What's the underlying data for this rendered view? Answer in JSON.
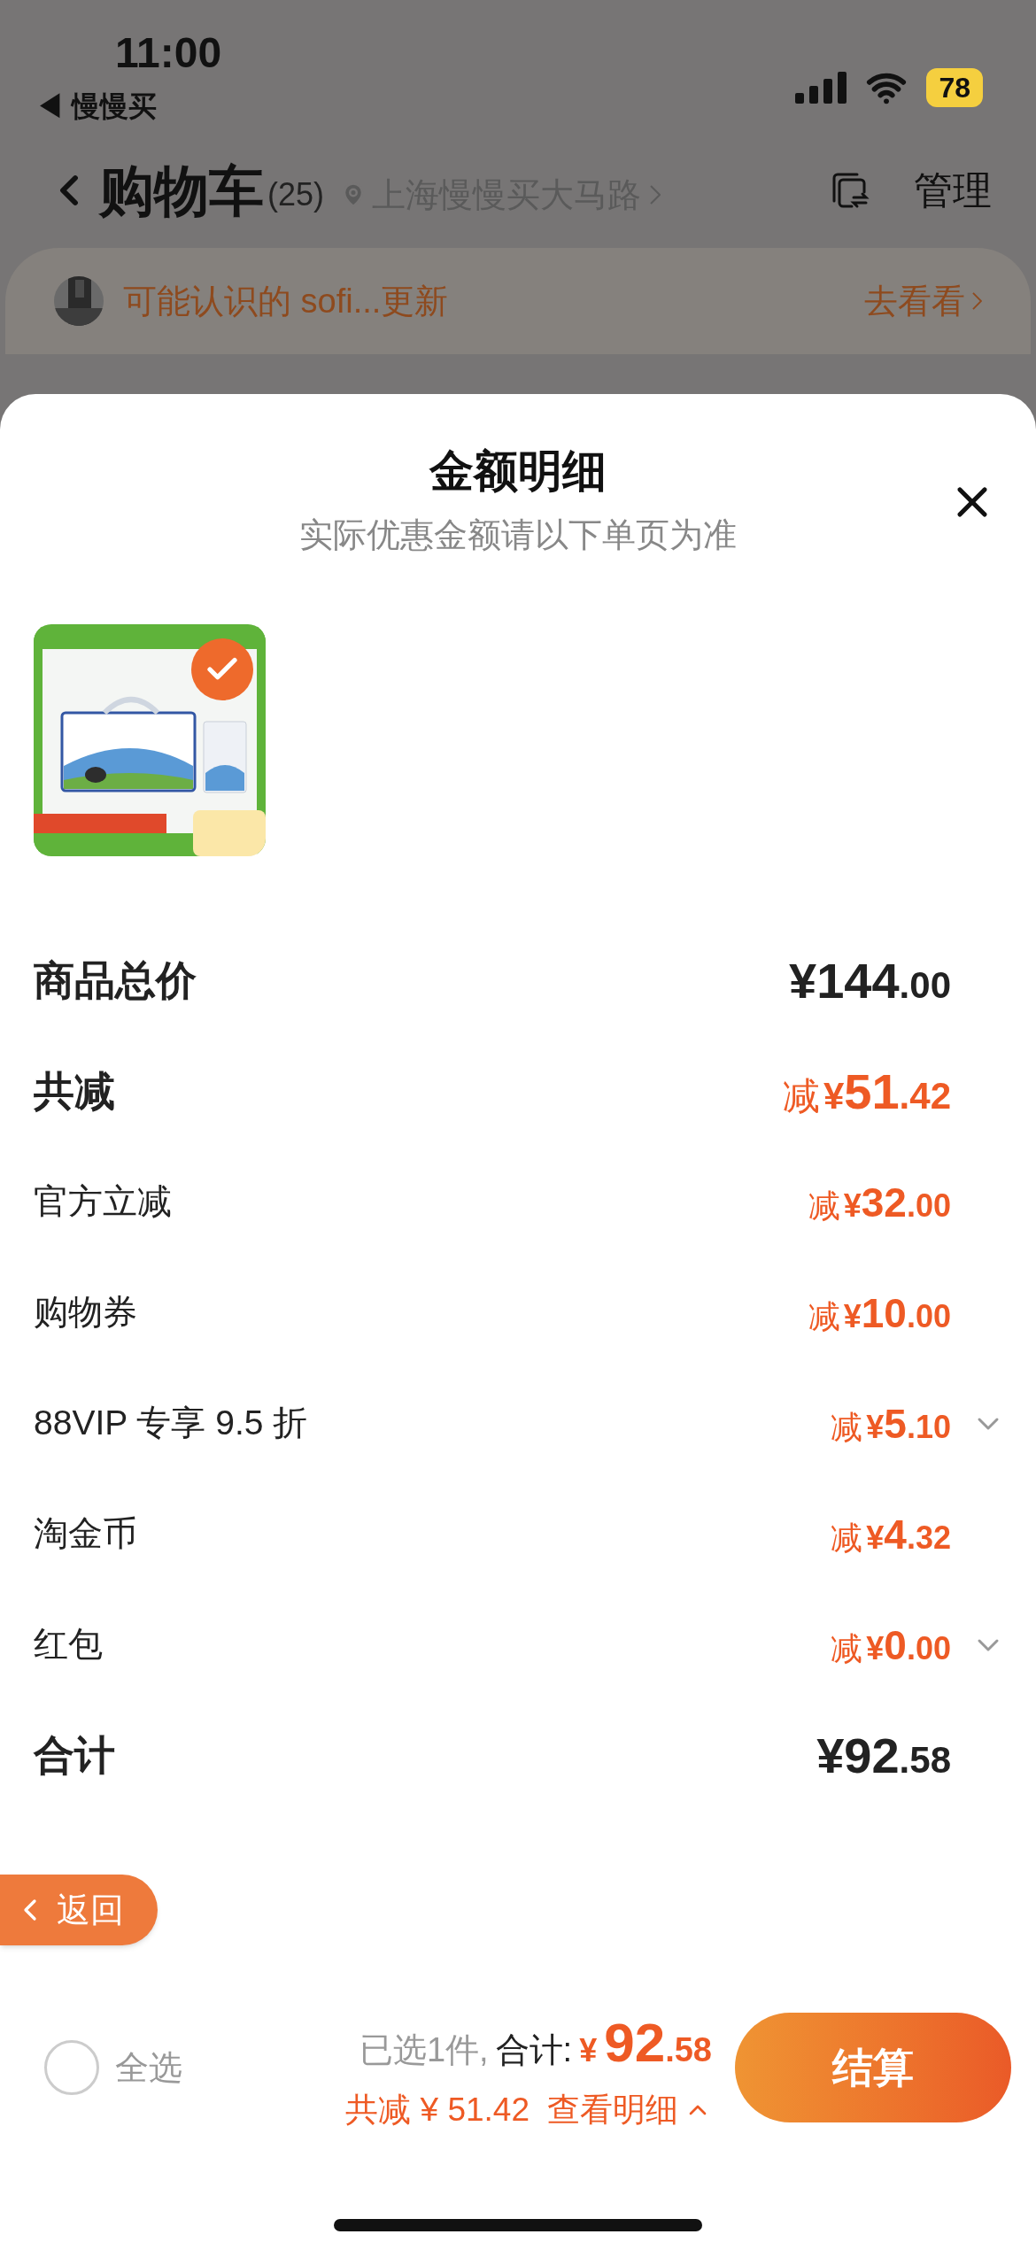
{
  "status_bar": {
    "time": "11:00",
    "back_app": "◀ 慢慢买",
    "battery": "78"
  },
  "header": {
    "title": "购物车",
    "count": "(25)",
    "location": "上海慢慢买大马路",
    "action": "管理"
  },
  "banner": {
    "text": "可能认识的 sofi...更新",
    "link": "去看看"
  },
  "sheet": {
    "title": "金额明细",
    "subtitle": "实际优惠金额请以下单页为准",
    "product": {
      "selected": true
    },
    "rows": [
      {
        "kind": "main",
        "label": "商品总价",
        "integer": "¥144",
        "fraction": ".00",
        "expandable": false
      },
      {
        "kind": "main",
        "label": "共减",
        "prefix": "减",
        "currency": "¥",
        "integer": "51",
        "fraction": ".42",
        "expandable": false
      },
      {
        "kind": "sub",
        "label": "官方立减",
        "prefix": "减",
        "currency": "¥",
        "integer": "32",
        "fraction": ".00",
        "expandable": false
      },
      {
        "kind": "sub",
        "label": "购物券",
        "prefix": "减",
        "currency": "¥",
        "integer": "10",
        "fraction": ".00",
        "expandable": false
      },
      {
        "kind": "sub",
        "label": "88VIP 专享 9.5 折",
        "prefix": "减",
        "currency": "¥",
        "integer": "5",
        "fraction": ".10",
        "expandable": true
      },
      {
        "kind": "sub",
        "label": "淘金币",
        "prefix": "减",
        "currency": "¥",
        "integer": "4",
        "fraction": ".32",
        "expandable": false
      },
      {
        "kind": "sub",
        "label": "红包",
        "prefix": "减",
        "currency": "¥",
        "integer": "0",
        "fraction": ".00",
        "expandable": true
      },
      {
        "kind": "main",
        "label": "合计",
        "integer": "¥92",
        "fraction": ".58",
        "expandable": false
      }
    ]
  },
  "back_button": "返回",
  "bottom_bar": {
    "select_all": {
      "label": "全选",
      "checked": false
    },
    "selected_count": "已选1件,",
    "total_label": "合计:",
    "currency": "¥",
    "total_integer": "92",
    "total_fraction": ".58",
    "discount": "共减 ¥ 51.42",
    "details_link": "查看明细",
    "expanded": true,
    "checkout": "结算"
  }
}
